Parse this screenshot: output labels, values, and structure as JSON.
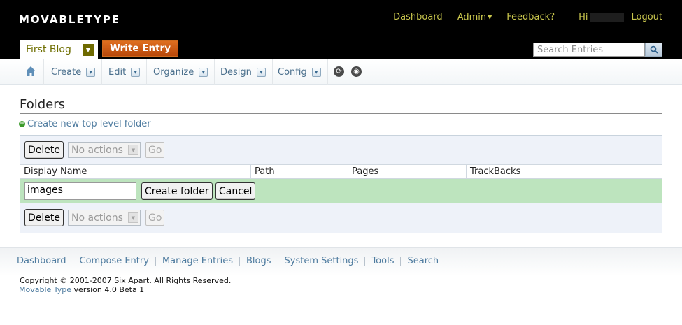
{
  "header": {
    "logo_text": "MOVABLETYPE",
    "blog_name": "First Blog",
    "write_entry_label": "Write Entry",
    "search_placeholder": "Search Entries",
    "util_nav": {
      "dashboard": "Dashboard",
      "admin": "Admin",
      "feedback": "Feedback?",
      "hi": "Hi",
      "logout": "Logout"
    }
  },
  "menubar": {
    "items": [
      {
        "label": "Create"
      },
      {
        "label": "Edit"
      },
      {
        "label": "Organize"
      },
      {
        "label": "Design"
      },
      {
        "label": "Config"
      }
    ]
  },
  "main": {
    "page_title": "Folders",
    "create_link": "Create new top level folder",
    "actions": {
      "delete_label": "Delete",
      "select_value": "No actions",
      "go_label": "Go"
    },
    "columns": [
      "Display Name",
      "Path",
      "Pages",
      "TrackBacks"
    ],
    "edit_row": {
      "input_value": "images",
      "create_folder_label": "Create folder",
      "cancel_label": "Cancel"
    }
  },
  "footer": {
    "nav": [
      "Dashboard",
      "Compose Entry",
      "Manage Entries",
      "Blogs",
      "System Settings",
      "Tools",
      "Search"
    ],
    "copyright": "Copyright © 2001-2007 Six Apart. All Rights Reserved.",
    "version_link": "Movable Type",
    "version_text": " version 4.0 Beta 1"
  },
  "colors": {
    "accent_orange": "#c85a14",
    "header_bg": "#000000",
    "link_blue": "#4e7b9f",
    "util_nav_yellow": "#c9c64d",
    "edit_row_green": "#bde4be"
  },
  "icons": {
    "home": "home-icon",
    "refresh": "refresh-icon",
    "view": "view-site-icon",
    "search": "search-icon"
  }
}
